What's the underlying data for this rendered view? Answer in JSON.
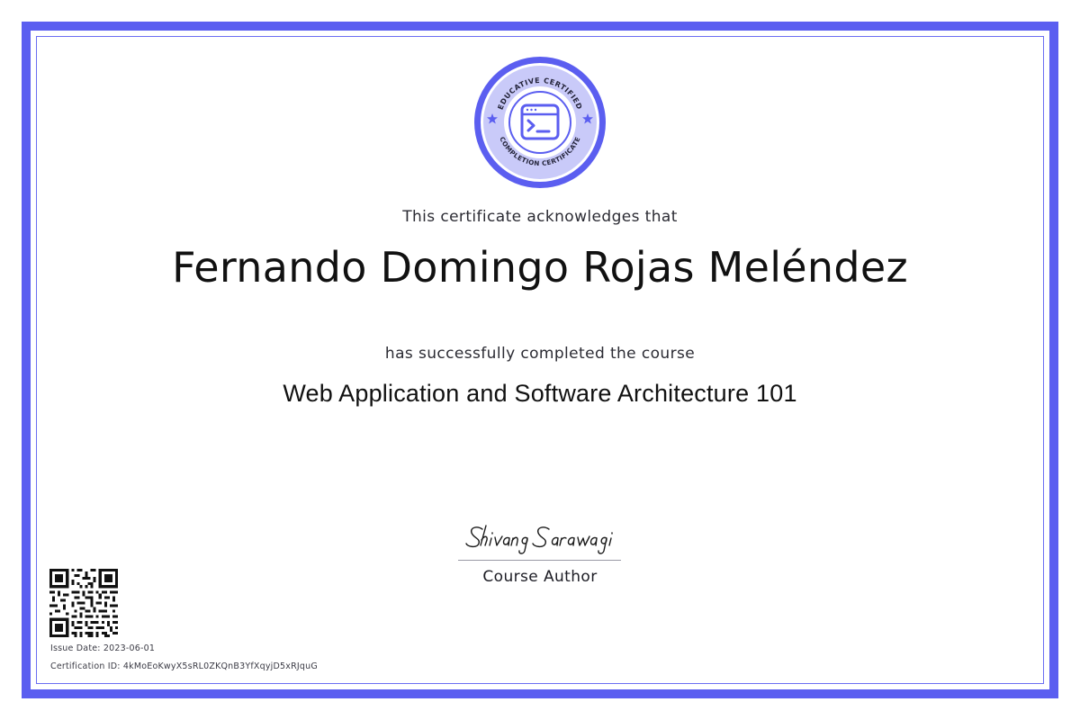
{
  "badge": {
    "top_text": "EDUCATIVE CERTIFIED",
    "bottom_text": "COMPLETION CERTIFICATE",
    "icon": "terminal-window-icon",
    "color": "#5b5ef0"
  },
  "certificate": {
    "acknowledge_text": "This certificate acknowledges that",
    "recipient_name": "Fernando Domingo Rojas Meléndez",
    "completed_text": "has successfully completed the course",
    "course_title": "Web Application and Software Architecture 101"
  },
  "signatory": {
    "signature": "Shivang Sarawagi",
    "role": "Course Author"
  },
  "footer": {
    "issue_date": "Issue Date: 2023-06-01",
    "certification_id": "Certification ID: 4kMoEoKwyX5sRL0ZKQnB3YfXqyjD5xRJquG"
  },
  "colors": {
    "accent": "#5b5ef0",
    "badge_fill": "#c9caf9",
    "text": "#111111"
  }
}
